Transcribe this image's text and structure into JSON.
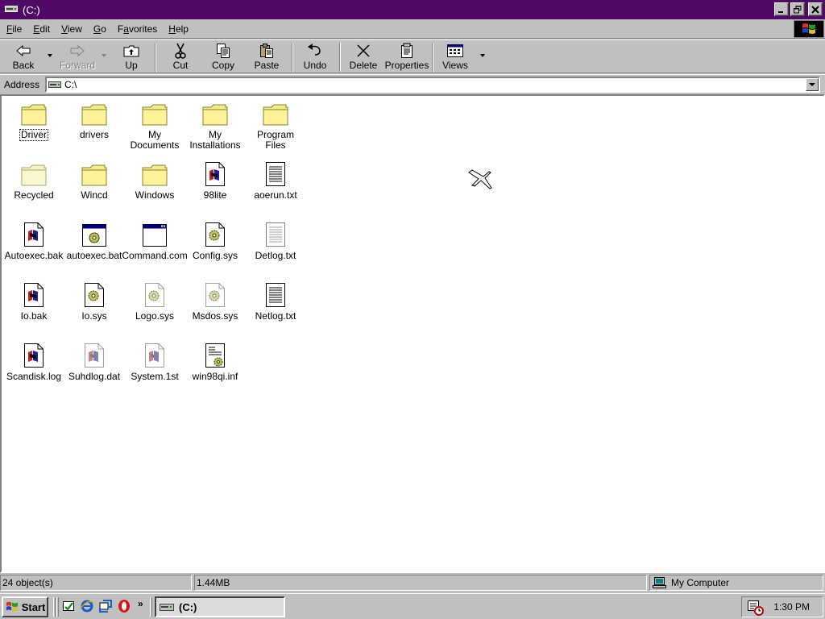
{
  "window": {
    "title": "(C:)"
  },
  "menu": [
    {
      "label": "File",
      "key": "F",
      "rest": "ile"
    },
    {
      "label": "Edit",
      "key": "E",
      "rest": "dit"
    },
    {
      "label": "View",
      "key": "V",
      "rest": "iew"
    },
    {
      "label": "Go",
      "key": "G",
      "rest": "o"
    },
    {
      "label": "Favorites",
      "key": "F",
      "rest": "avorites",
      "pre": "F",
      "ul": "a",
      "post": "vorites"
    },
    {
      "label": "Help",
      "key": "H",
      "rest": "elp"
    }
  ],
  "toolbar": {
    "back": "Back",
    "forward": "Forward",
    "up": "Up",
    "cut": "Cut",
    "copy": "Copy",
    "paste": "Paste",
    "undo": "Undo",
    "delete": "Delete",
    "properties": "Properties",
    "views": "Views"
  },
  "address": {
    "label": "Address",
    "value": "C:\\"
  },
  "files": [
    {
      "name": "Driver",
      "icon": "folder-icon"
    },
    {
      "name": "drivers",
      "icon": "folder-icon"
    },
    {
      "name": "My Documents",
      "icon": "folder-icon"
    },
    {
      "name": "My\nInstallations",
      "icon": "folder-icon"
    },
    {
      "name": "Program Files",
      "icon": "folder-icon"
    },
    {
      "name": "Recycled",
      "icon": "recycled-folder-icon"
    },
    {
      "name": "Wincd",
      "icon": "folder-icon"
    },
    {
      "name": "Windows",
      "icon": "folder-icon"
    },
    {
      "name": "98lite",
      "icon": "windows-file-icon"
    },
    {
      "name": "aoerun.txt",
      "icon": "text-file-icon"
    },
    {
      "name": "Autoexec.bak",
      "icon": "windows-file-icon"
    },
    {
      "name": "autoexec.bat",
      "icon": "batch-file-icon"
    },
    {
      "name": "Command.com",
      "icon": "program-icon"
    },
    {
      "name": "Config.sys",
      "icon": "system-file-icon"
    },
    {
      "name": "Detlog.txt",
      "icon": "text-file-icon"
    },
    {
      "name": "Io.bak",
      "icon": "windows-file-icon"
    },
    {
      "name": "Io.sys",
      "icon": "system-file-icon"
    },
    {
      "name": "Logo.sys",
      "icon": "system-file-icon"
    },
    {
      "name": "Msdos.sys",
      "icon": "system-file-icon"
    },
    {
      "name": "Netlog.txt",
      "icon": "text-file-icon"
    },
    {
      "name": "Scandisk.log",
      "icon": "windows-file-icon"
    },
    {
      "name": "Suhdlog.dat",
      "icon": "windows-file-icon"
    },
    {
      "name": "System.1st",
      "icon": "windows-file-icon"
    },
    {
      "name": "win98qi.inf",
      "icon": "setup-info-icon"
    }
  ],
  "status": {
    "objects": "24 object(s)",
    "size": "1.44MB",
    "zone": "My Computer"
  },
  "taskbar": {
    "start": "Start",
    "task": "(C:)",
    "clock": "1:30 PM"
  }
}
